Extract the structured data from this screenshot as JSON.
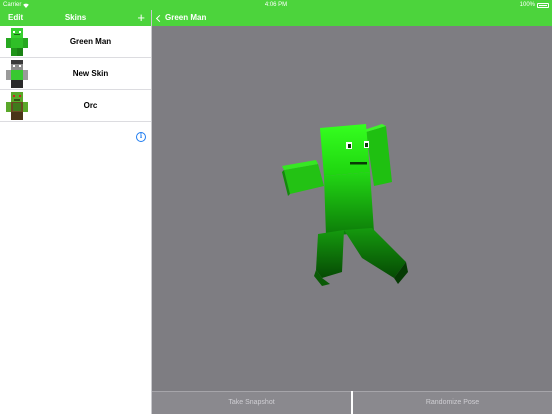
{
  "status_bar": {
    "carrier": "Carrier",
    "time": "4:06 PM",
    "battery": "100%"
  },
  "sidebar": {
    "edit_label": "Edit",
    "title": "Skins",
    "add_label": "+",
    "items": [
      {
        "label": "Green Man",
        "thumbnail": "green-man-skin"
      },
      {
        "label": "New Skin",
        "thumbnail": "new-skin"
      },
      {
        "label": "Orc",
        "thumbnail": "orc-skin"
      }
    ]
  },
  "detail": {
    "back_label": "Green Man",
    "model": "green-man-3d-model"
  },
  "toolbar": {
    "snapshot_label": "Take Snapshot",
    "randomize_label": "Randomize Pose"
  },
  "icons": {
    "info": "info-icon",
    "back": "chevron-left-icon",
    "add": "plus-icon"
  },
  "colors": {
    "nav_green": "#4cd43c",
    "viewport_gray": "#7e7d82",
    "button_gray": "#8a898e",
    "info_blue": "#1e7cf0"
  }
}
